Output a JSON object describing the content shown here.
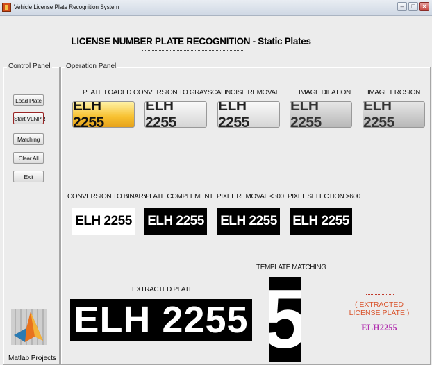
{
  "window": {
    "title": "Vehicle License Plate Recognition System",
    "minimize": "–",
    "maximize": "□",
    "close": "×"
  },
  "app": {
    "title": "LICENSE  NUMBER PLATE RECOGNITION - Static Plates"
  },
  "control_panel": {
    "label": "Control Panel",
    "buttons": [
      "Load Plate",
      "Start VLNPR",
      "Matching",
      "Clear All",
      "Exit"
    ],
    "logo_caption": "Matlab Projects"
  },
  "operation_panel": {
    "label": "Operation Panel",
    "stages": [
      {
        "label": "PLATE LOADED",
        "plate": "ELH 2255"
      },
      {
        "label": "CONVERSION TO GRAYSCALE",
        "plate": "ELH 2255"
      },
      {
        "label": "NOISE REMOVAL",
        "plate": "ELH 2255"
      },
      {
        "label": "IMAGE DILATION",
        "plate": "ELH 2255"
      },
      {
        "label": "IMAGE EROSION",
        "plate": "ELH 2255"
      },
      {
        "label": "CONVERSION TO BINARY",
        "plate": "ELH 2255"
      },
      {
        "label": "PLATE COMPLEMENT",
        "plate": "ELH 2255"
      },
      {
        "label": "PIXEL REMOVAL <300",
        "plate": "ELH 2255"
      },
      {
        "label": "PIXEL SELECTION >600",
        "plate": "ELH 2255"
      }
    ],
    "extracted": {
      "label": "EXTRACTED PLATE",
      "text": "ELH 2255"
    },
    "template": {
      "label": "TEMPLATE MATCHING",
      "char": "5"
    },
    "result": {
      "title": "( EXTRACTED  LICENSE PLATE )",
      "value": "ELH2255"
    }
  },
  "colors": {
    "result_title": "#d9542c",
    "result_value": "#b233b0",
    "plate_yellow": "#f7c02f"
  }
}
